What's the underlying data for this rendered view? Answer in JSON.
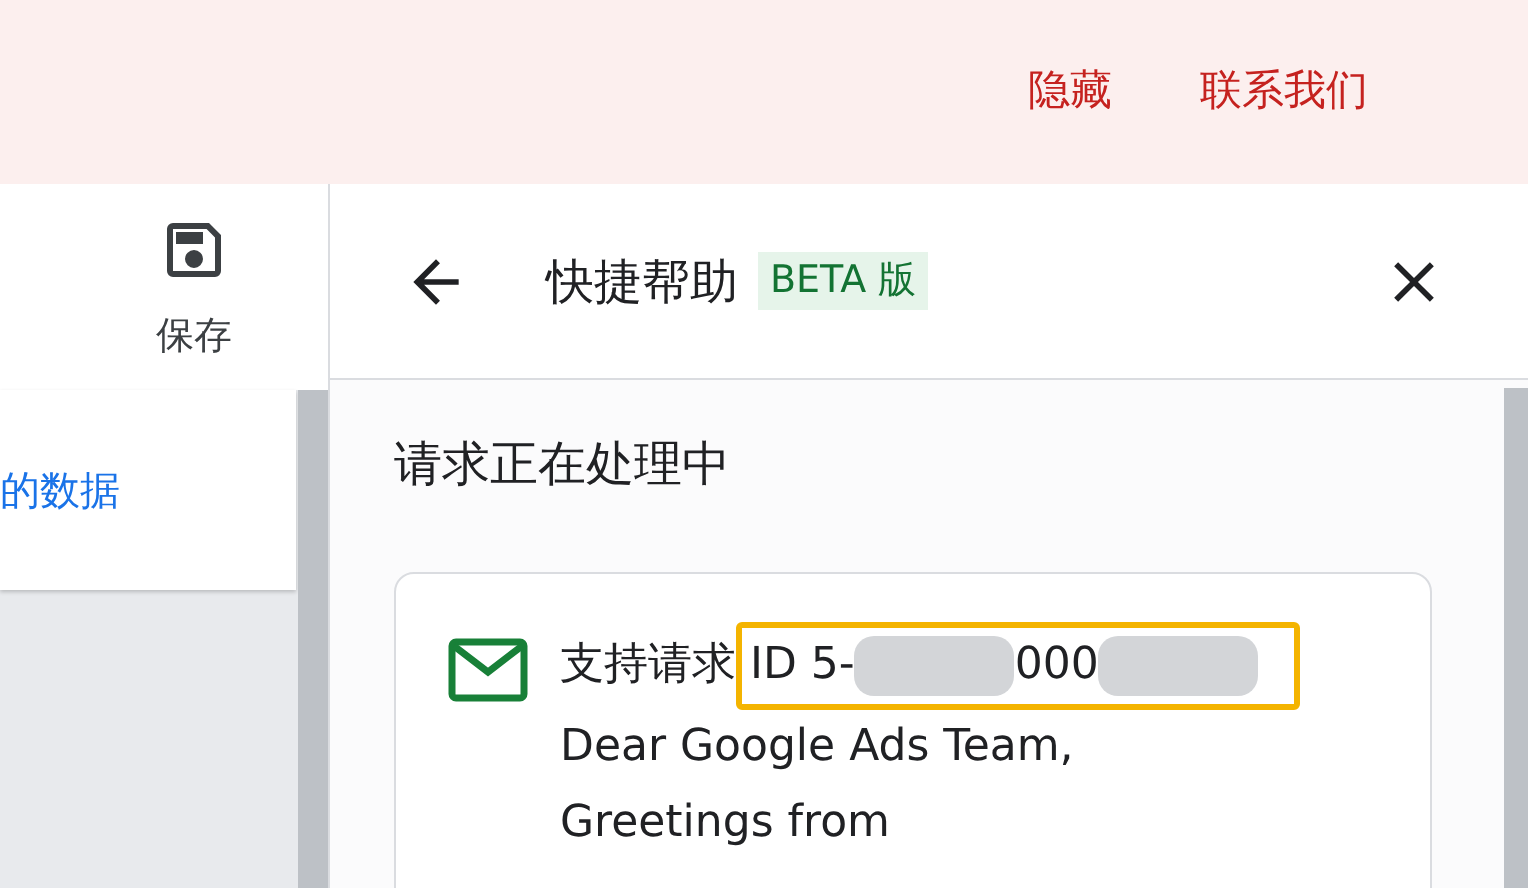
{
  "top_bar": {
    "links": [
      "隐藏",
      "联系我们"
    ]
  },
  "toolbar": {
    "save_label": "保存"
  },
  "left_card": {
    "link": "的数据"
  },
  "help_panel": {
    "title": "快捷帮助",
    "badge": "BETA 版",
    "status": "请求正在处理中",
    "request": {
      "label": "支持请求",
      "id_parts": [
        "ID 5-",
        "000"
      ],
      "highlighted": true,
      "lines": [
        "Dear Google Ads Team,",
        "Greetings from"
      ]
    }
  }
}
